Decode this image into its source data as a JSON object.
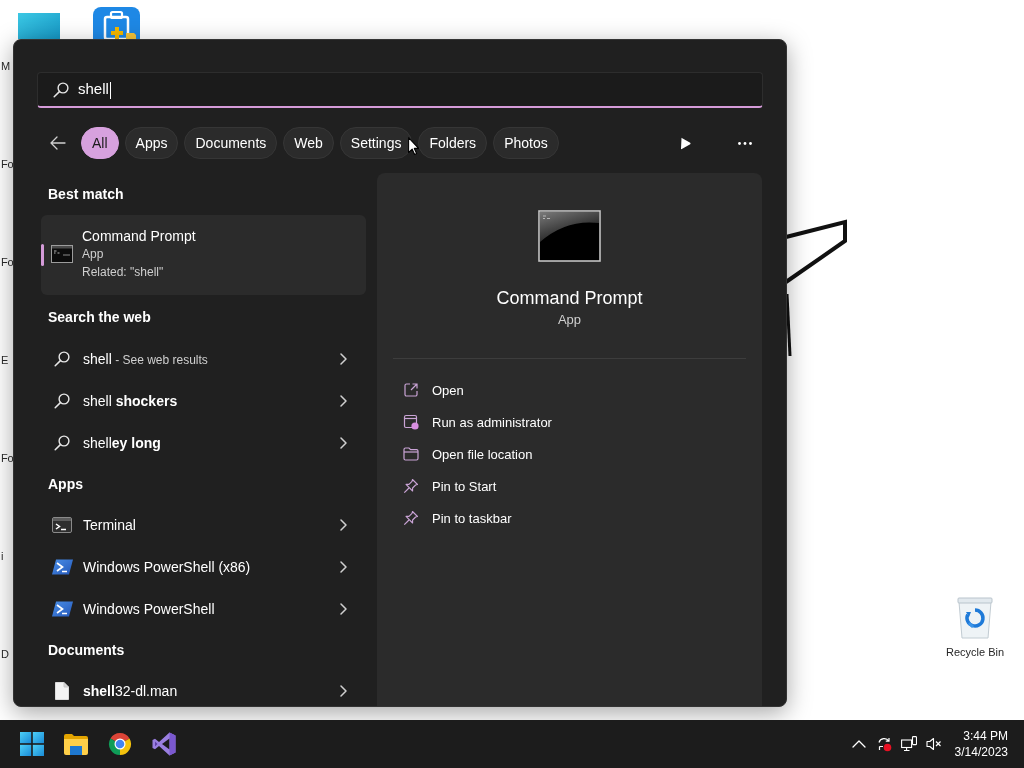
{
  "desktop": {
    "edge_labels": [
      "M",
      "Fo",
      "Fo",
      "E",
      "Fo",
      "i",
      "D"
    ],
    "recycle_bin": {
      "label": "Recycle Bin"
    }
  },
  "search": {
    "value": "shell"
  },
  "filters": [
    {
      "label": "All",
      "selected": true
    },
    {
      "label": "Apps",
      "selected": false
    },
    {
      "label": "Documents",
      "selected": false
    },
    {
      "label": "Web",
      "selected": false
    },
    {
      "label": "Settings",
      "selected": false
    },
    {
      "label": "Folders",
      "selected": false
    },
    {
      "label": "Photos",
      "selected": false
    }
  ],
  "best_match": {
    "heading": "Best match",
    "title": "Command Prompt",
    "type": "App",
    "related": "Related: \"shell\"",
    "selected": true
  },
  "sections": [
    {
      "heading": "Search the web",
      "items": [
        {
          "kind": "web",
          "text": "shell",
          "suffix": "- See web results"
        },
        {
          "kind": "web",
          "text": "shell **shockers**"
        },
        {
          "kind": "web",
          "text": "shell**ey long**"
        }
      ]
    },
    {
      "heading": "Apps",
      "items": [
        {
          "kind": "terminal",
          "text": "Terminal"
        },
        {
          "kind": "powershell",
          "text": "Windows PowerShell (x86)"
        },
        {
          "kind": "powershell",
          "text": "Windows PowerShell"
        }
      ]
    },
    {
      "heading": "Documents",
      "items": [
        {
          "kind": "document",
          "text": "**shell**32-dl.man"
        }
      ]
    }
  ],
  "preview": {
    "title": "Command Prompt",
    "type": "App",
    "actions": [
      {
        "kind": "open",
        "label": "Open"
      },
      {
        "kind": "admin",
        "label": "Run as administrator"
      },
      {
        "kind": "folder",
        "label": "Open file location"
      },
      {
        "kind": "pin",
        "label": "Pin to Start"
      },
      {
        "kind": "pin",
        "label": "Pin to taskbar"
      }
    ]
  },
  "taskbar": {
    "time": "3:44 PM",
    "date": "3/14/2023"
  }
}
